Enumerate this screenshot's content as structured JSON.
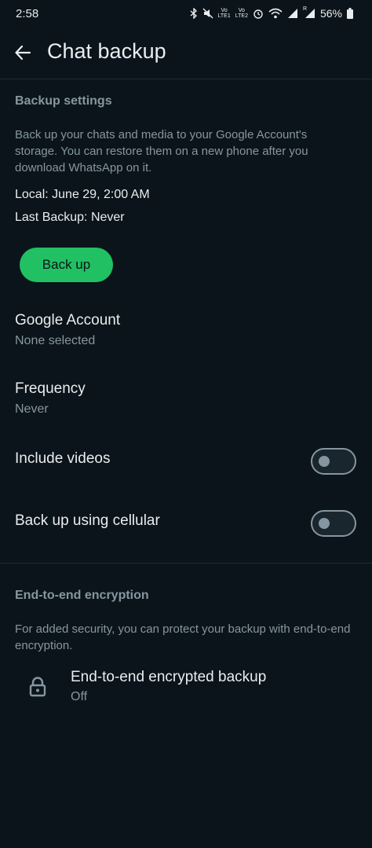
{
  "status_bar": {
    "time": "2:58",
    "lte1_top": "Vo",
    "lte1_bottom": "LTE1",
    "lte2_top": "Vo",
    "lte2_bottom": "LTE2",
    "signal1_badge": "R",
    "battery": "56%",
    "icons": [
      "bluetooth-icon",
      "mute-icon",
      "alarm-icon",
      "wifi-icon",
      "signal-icon",
      "battery-icon"
    ]
  },
  "header": {
    "title": "Chat backup",
    "back_icon": "arrow-back-icon"
  },
  "backup_settings": {
    "section_title": "Backup settings",
    "description": "Back up your chats and media to your Google Account's storage. You can restore them on a new phone after you download WhatsApp on it.",
    "local": "Local: June 29, 2:00 AM",
    "last_backup": "Last Backup: Never",
    "backup_button": "Back up"
  },
  "google_account": {
    "title": "Google Account",
    "value": "None selected"
  },
  "frequency": {
    "title": "Frequency",
    "value": "Never"
  },
  "include_videos": {
    "title": "Include videos",
    "enabled": false
  },
  "cellular": {
    "title": "Back up using cellular",
    "enabled": false
  },
  "encryption": {
    "section_title": "End-to-end encryption",
    "description": "For added security, you can protect your backup with end-to-end encryption.",
    "item_title": "End-to-end encrypted backup",
    "item_value": "Off",
    "icon": "lock-icon"
  },
  "colors": {
    "background": "#0b141a",
    "accent": "#21c063",
    "secondary_text": "#8696a0",
    "primary_text": "#e9edef"
  }
}
